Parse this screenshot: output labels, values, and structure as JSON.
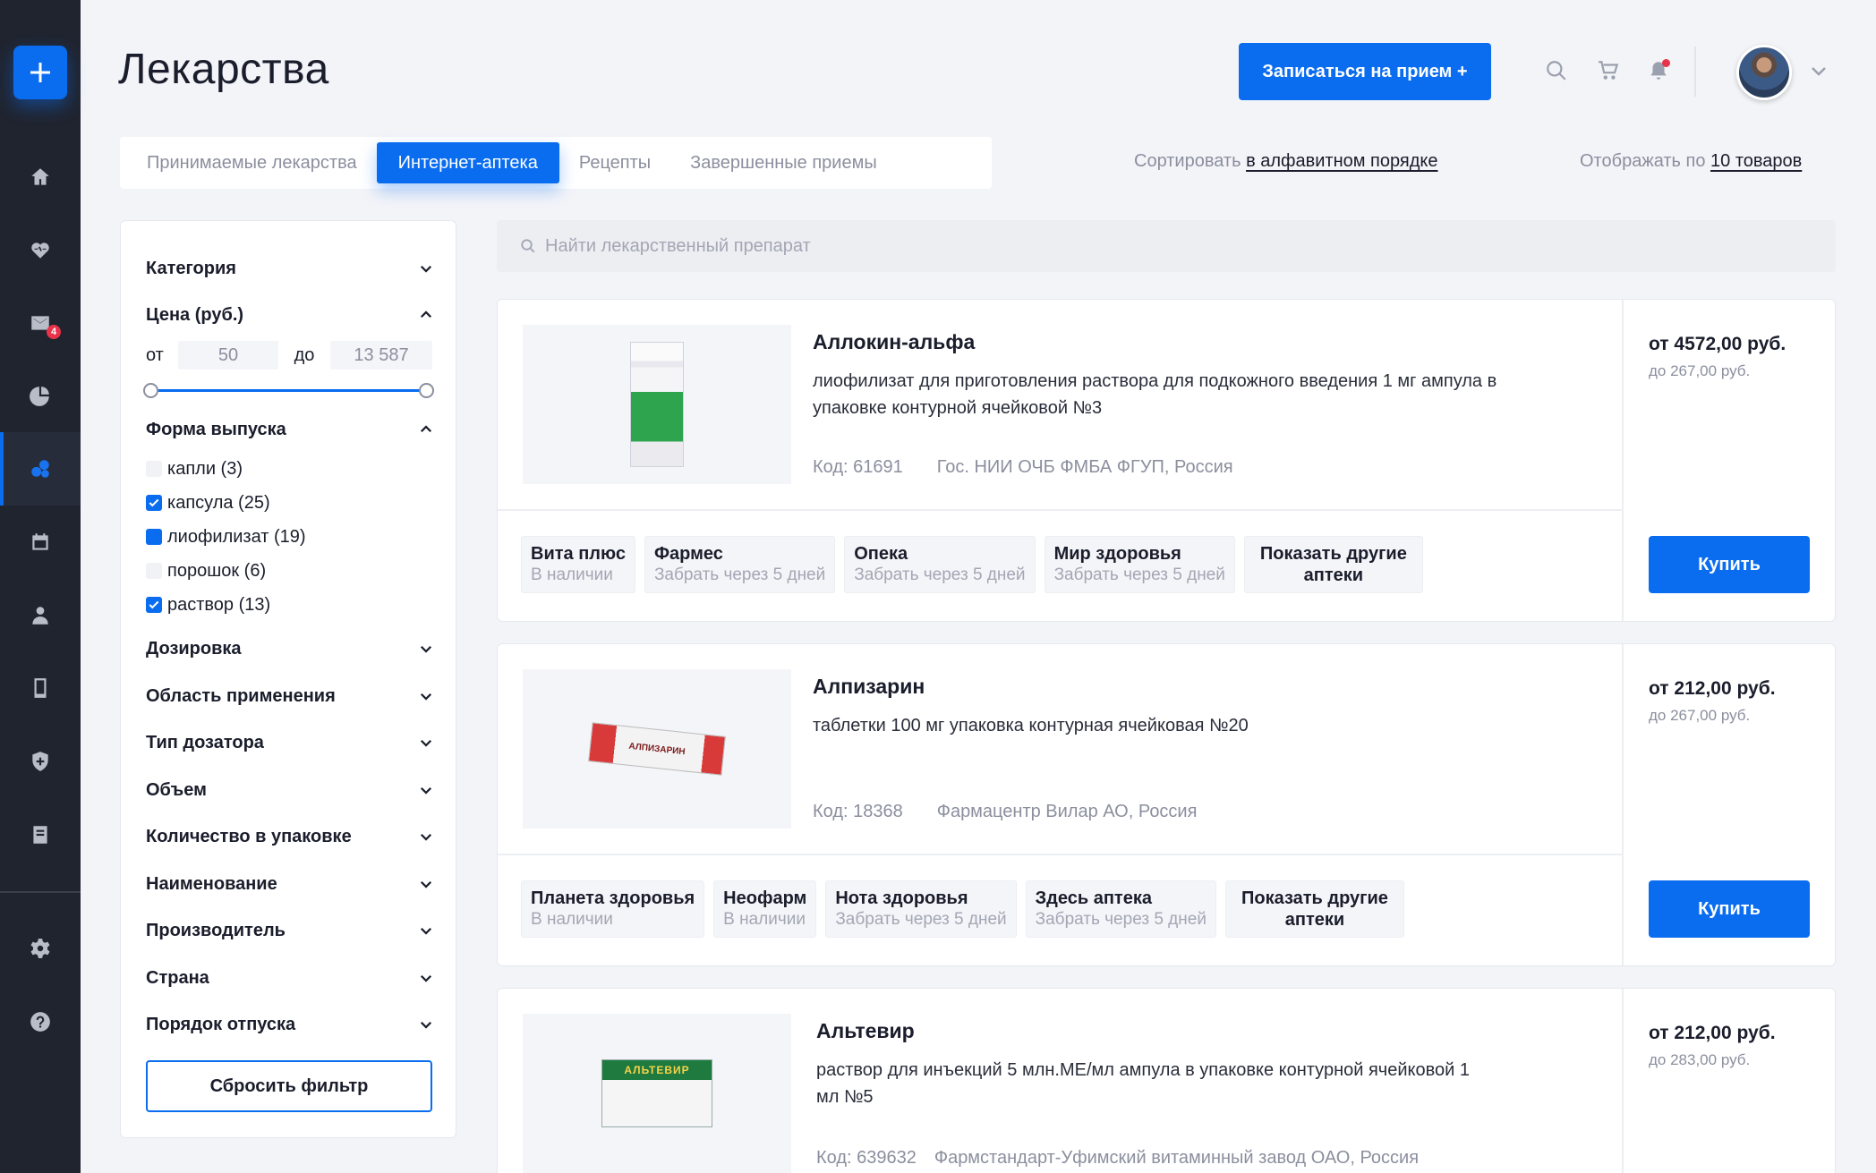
{
  "sidebar": {
    "icons": [
      "plus-icon",
      "home-icon",
      "heart-rate-icon",
      "mail-icon",
      "pie-chart-icon",
      "pharmacy-icon",
      "calendar-icon",
      "doctor-icon",
      "tablet-icon",
      "shield-icon",
      "book-icon",
      "settings-icon",
      "help-icon"
    ],
    "mail_badge": "4"
  },
  "header": {
    "title": "Лекарства",
    "appointment_button": "Записаться на прием +"
  },
  "tabs": [
    {
      "label": "Принимаемые лекарства",
      "active": false
    },
    {
      "label": "Интернет-аптека",
      "active": true
    },
    {
      "label": "Рецепты",
      "active": false
    },
    {
      "label": "Завершенные приемы",
      "active": false
    }
  ],
  "sort": {
    "prefix": "Сортировать",
    "value": "в алфавитном порядке"
  },
  "display": {
    "prefix": "Отображать по",
    "value": "10 товаров"
  },
  "filters": {
    "category": "Категория",
    "price": "Цена (руб.)",
    "price_from_label": "от",
    "price_from": "50",
    "price_to_label": "до",
    "price_to": "13 587",
    "form": "Форма выпуска",
    "form_options": [
      {
        "label": "капли (3)",
        "state": "off"
      },
      {
        "label": "капсула (25)",
        "state": "on"
      },
      {
        "label": "лиофилизат (19)",
        "state": "partial"
      },
      {
        "label": "порошок (6)",
        "state": "off"
      },
      {
        "label": "раствор (13)",
        "state": "on"
      }
    ],
    "collapsed": [
      "Дозировка",
      "Область применения",
      "Тип дозатора",
      "Объем",
      "Количество в упаковке",
      "Наименование",
      "Производитель",
      "Страна",
      "Порядок отпуска"
    ],
    "reset": "Сбросить фильтр"
  },
  "search": {
    "placeholder": "Найти лекарственный препарат"
  },
  "products": [
    {
      "name": "Аллокин-альфа",
      "description": "лиофилизат для приготовления раствора для подкожного введения 1 мг ампула в упаковке контурной ячейковой №3",
      "code": "Код: 61691",
      "manufacturer": "Гос. НИИ ОЧБ ФМБА ФГУП, Россия",
      "price": "от 4572,00 руб.",
      "price_max": "до 267,00 руб.",
      "buy": "Купить",
      "pharmacies": [
        {
          "name": "Вита плюс",
          "status": "В наличии"
        },
        {
          "name": "Фармес",
          "status": "Забрать через 5 дней"
        },
        {
          "name": "Опека",
          "status": "Забрать через 5 дней"
        },
        {
          "name": "Мир здоровья",
          "status": "Забрать через 5 дней"
        }
      ],
      "more": "Показать другие аптеки"
    },
    {
      "name": "Алпизарин",
      "description": "таблетки 100 мг упаковка контурная ячейковая №20",
      "code": "Код: 18368",
      "manufacturer": "Фармацентр Вилар АО, Россия",
      "price": "от 212,00 руб.",
      "price_max": "до 267,00 руб.",
      "buy": "Купить",
      "box_label": "АЛПИЗАРИН",
      "pharmacies": [
        {
          "name": "Планета здоровья",
          "status": "В наличии"
        },
        {
          "name": "Неофарм",
          "status": "В наличии"
        },
        {
          "name": "Нота здоровья",
          "status": "Забрать через 5 дней"
        },
        {
          "name": "Здесь аптека",
          "status": "Забрать через 5 дней"
        }
      ],
      "more": "Показать другие аптеки"
    },
    {
      "name": "Альтевир",
      "description": "раствор для инъекций 5 млн.МЕ/мл ампула в упаковке контурной ячейковой 1 мл №5",
      "code": "Код: 639632",
      "manufacturer": "Фармстандарт-Уфимский витаминный завод ОАО, Россия",
      "price": "от 212,00 руб.",
      "price_max": "до 283,00 руб.",
      "box_label": "АЛЬТЕВИР"
    }
  ]
}
